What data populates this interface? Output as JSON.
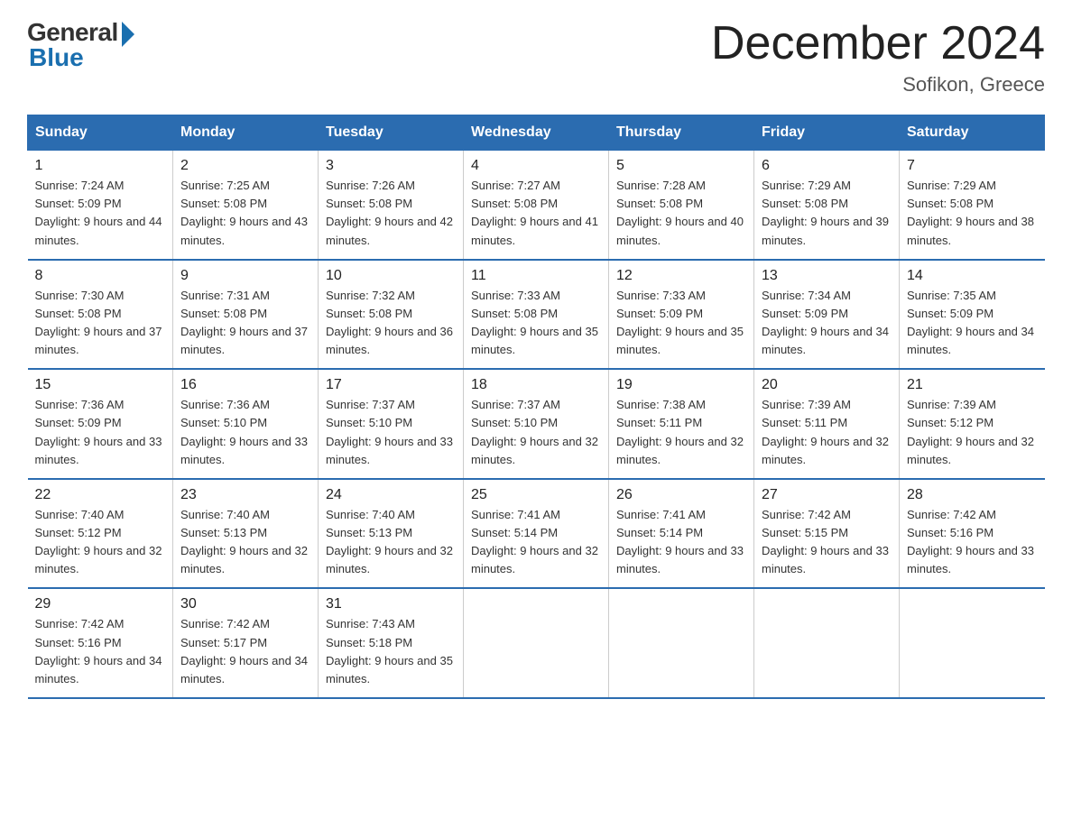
{
  "header": {
    "logo_general": "General",
    "logo_blue": "Blue",
    "title": "December 2024",
    "location": "Sofikon, Greece"
  },
  "calendar": {
    "days_of_week": [
      "Sunday",
      "Monday",
      "Tuesday",
      "Wednesday",
      "Thursday",
      "Friday",
      "Saturday"
    ],
    "weeks": [
      [
        {
          "day": "1",
          "sunrise": "7:24 AM",
          "sunset": "5:09 PM",
          "daylight": "9 hours and 44 minutes."
        },
        {
          "day": "2",
          "sunrise": "7:25 AM",
          "sunset": "5:08 PM",
          "daylight": "9 hours and 43 minutes."
        },
        {
          "day": "3",
          "sunrise": "7:26 AM",
          "sunset": "5:08 PM",
          "daylight": "9 hours and 42 minutes."
        },
        {
          "day": "4",
          "sunrise": "7:27 AM",
          "sunset": "5:08 PM",
          "daylight": "9 hours and 41 minutes."
        },
        {
          "day": "5",
          "sunrise": "7:28 AM",
          "sunset": "5:08 PM",
          "daylight": "9 hours and 40 minutes."
        },
        {
          "day": "6",
          "sunrise": "7:29 AM",
          "sunset": "5:08 PM",
          "daylight": "9 hours and 39 minutes."
        },
        {
          "day": "7",
          "sunrise": "7:29 AM",
          "sunset": "5:08 PM",
          "daylight": "9 hours and 38 minutes."
        }
      ],
      [
        {
          "day": "8",
          "sunrise": "7:30 AM",
          "sunset": "5:08 PM",
          "daylight": "9 hours and 37 minutes."
        },
        {
          "day": "9",
          "sunrise": "7:31 AM",
          "sunset": "5:08 PM",
          "daylight": "9 hours and 37 minutes."
        },
        {
          "day": "10",
          "sunrise": "7:32 AM",
          "sunset": "5:08 PM",
          "daylight": "9 hours and 36 minutes."
        },
        {
          "day": "11",
          "sunrise": "7:33 AM",
          "sunset": "5:08 PM",
          "daylight": "9 hours and 35 minutes."
        },
        {
          "day": "12",
          "sunrise": "7:33 AM",
          "sunset": "5:09 PM",
          "daylight": "9 hours and 35 minutes."
        },
        {
          "day": "13",
          "sunrise": "7:34 AM",
          "sunset": "5:09 PM",
          "daylight": "9 hours and 34 minutes."
        },
        {
          "day": "14",
          "sunrise": "7:35 AM",
          "sunset": "5:09 PM",
          "daylight": "9 hours and 34 minutes."
        }
      ],
      [
        {
          "day": "15",
          "sunrise": "7:36 AM",
          "sunset": "5:09 PM",
          "daylight": "9 hours and 33 minutes."
        },
        {
          "day": "16",
          "sunrise": "7:36 AM",
          "sunset": "5:10 PM",
          "daylight": "9 hours and 33 minutes."
        },
        {
          "day": "17",
          "sunrise": "7:37 AM",
          "sunset": "5:10 PM",
          "daylight": "9 hours and 33 minutes."
        },
        {
          "day": "18",
          "sunrise": "7:37 AM",
          "sunset": "5:10 PM",
          "daylight": "9 hours and 32 minutes."
        },
        {
          "day": "19",
          "sunrise": "7:38 AM",
          "sunset": "5:11 PM",
          "daylight": "9 hours and 32 minutes."
        },
        {
          "day": "20",
          "sunrise": "7:39 AM",
          "sunset": "5:11 PM",
          "daylight": "9 hours and 32 minutes."
        },
        {
          "day": "21",
          "sunrise": "7:39 AM",
          "sunset": "5:12 PM",
          "daylight": "9 hours and 32 minutes."
        }
      ],
      [
        {
          "day": "22",
          "sunrise": "7:40 AM",
          "sunset": "5:12 PM",
          "daylight": "9 hours and 32 minutes."
        },
        {
          "day": "23",
          "sunrise": "7:40 AM",
          "sunset": "5:13 PM",
          "daylight": "9 hours and 32 minutes."
        },
        {
          "day": "24",
          "sunrise": "7:40 AM",
          "sunset": "5:13 PM",
          "daylight": "9 hours and 32 minutes."
        },
        {
          "day": "25",
          "sunrise": "7:41 AM",
          "sunset": "5:14 PM",
          "daylight": "9 hours and 32 minutes."
        },
        {
          "day": "26",
          "sunrise": "7:41 AM",
          "sunset": "5:14 PM",
          "daylight": "9 hours and 33 minutes."
        },
        {
          "day": "27",
          "sunrise": "7:42 AM",
          "sunset": "5:15 PM",
          "daylight": "9 hours and 33 minutes."
        },
        {
          "day": "28",
          "sunrise": "7:42 AM",
          "sunset": "5:16 PM",
          "daylight": "9 hours and 33 minutes."
        }
      ],
      [
        {
          "day": "29",
          "sunrise": "7:42 AM",
          "sunset": "5:16 PM",
          "daylight": "9 hours and 34 minutes."
        },
        {
          "day": "30",
          "sunrise": "7:42 AM",
          "sunset": "5:17 PM",
          "daylight": "9 hours and 34 minutes."
        },
        {
          "day": "31",
          "sunrise": "7:43 AM",
          "sunset": "5:18 PM",
          "daylight": "9 hours and 35 minutes."
        },
        null,
        null,
        null,
        null
      ]
    ]
  }
}
